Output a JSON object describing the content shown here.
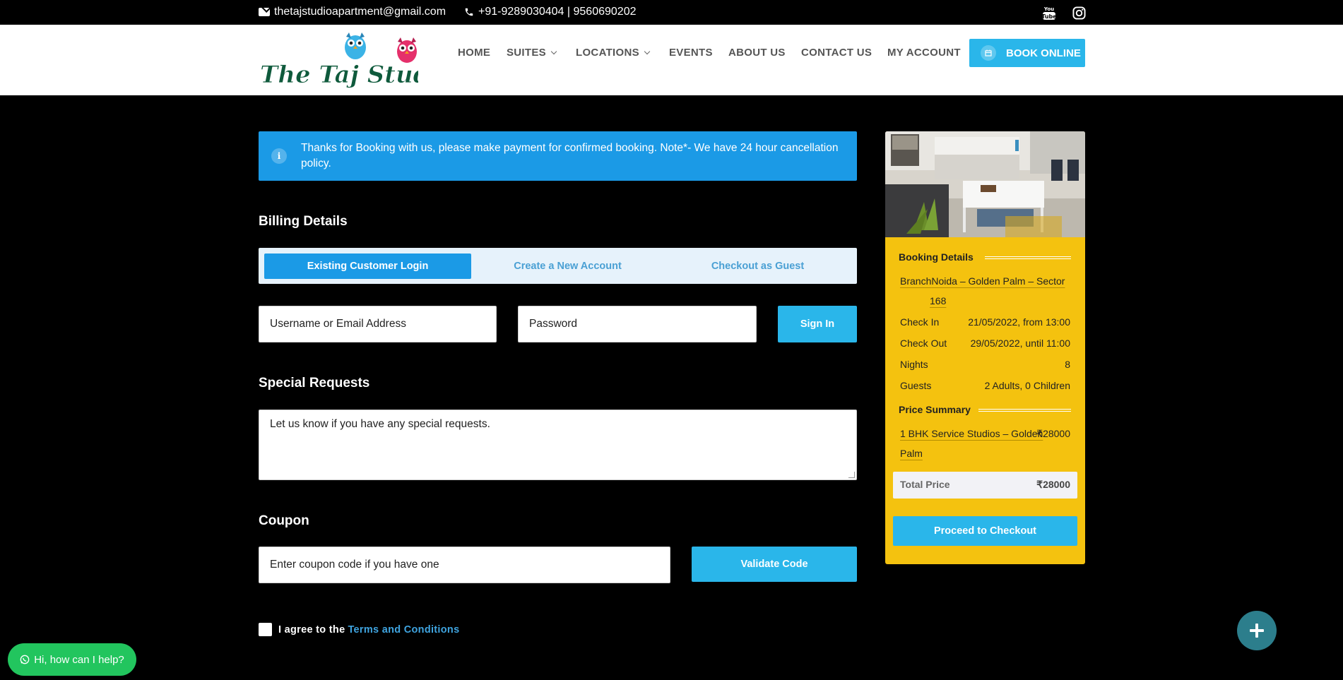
{
  "topbar": {
    "email": "thetajstudioapartment@gmail.com",
    "phone": "+91-9289030404 | 9560690202",
    "social_icons": [
      "youtube-icon",
      "instagram-icon"
    ]
  },
  "header": {
    "logo_text": "The Taj Studios",
    "nav": {
      "home": "HOME",
      "suites": "SUITES",
      "locations": "LOCATIONS",
      "events": "EVENTS",
      "about": "ABOUT US",
      "contact": "CONTACT US",
      "account": "MY ACCOUNT"
    },
    "book_label": "BOOK ONLINE"
  },
  "notice": {
    "text": "Thanks for Booking with us, please make payment for confirmed booking. Note*- We have 24 hour cancellation policy."
  },
  "billing": {
    "title": "Billing Details",
    "tabs": {
      "login": "Existing Customer Login",
      "create": "Create a New Account",
      "guest": "Checkout as Guest"
    },
    "username_placeholder": "Username or Email Address",
    "password_placeholder": "Password",
    "sign_in": "Sign In"
  },
  "special": {
    "title": "Special Requests",
    "placeholder": "Let us know if you have any special requests."
  },
  "coupon": {
    "title": "Coupon",
    "placeholder": "Enter coupon code if you have one",
    "button": "Validate Code"
  },
  "agree": {
    "prefix": "I agree to the",
    "link": "Terms and Conditions"
  },
  "booking": {
    "title": "Booking Details",
    "branch_label": "Branch",
    "branch_value_line1": "Noida – Golden Palm – Sector",
    "branch_value_line2": "168",
    "check_in_label": "Check In",
    "check_in_value": "21/05/2022, from 13:00",
    "check_out_label": "Check Out",
    "check_out_value": "29/05/2022, until 11:00",
    "nights_label": "Nights",
    "nights_value": "8",
    "guests_label": "Guests",
    "guests_value": "2 Adults, 0 Children",
    "price_title": "Price Summary",
    "item_line1": "1 BHK Service Studios – Golden",
    "item_line2": "Palm",
    "item_price": "₹28000",
    "total_label": "Total Price",
    "total_value": "₹28000",
    "checkout": "Proceed to Checkout"
  },
  "chat": {
    "label": "Hi, how can I help?"
  },
  "colors": {
    "accent_blue": "#2ab6ea",
    "notice_blue": "#1b9ae6",
    "sidebar_yellow": "#f4c20f",
    "whatsapp_green": "#22c55e"
  }
}
